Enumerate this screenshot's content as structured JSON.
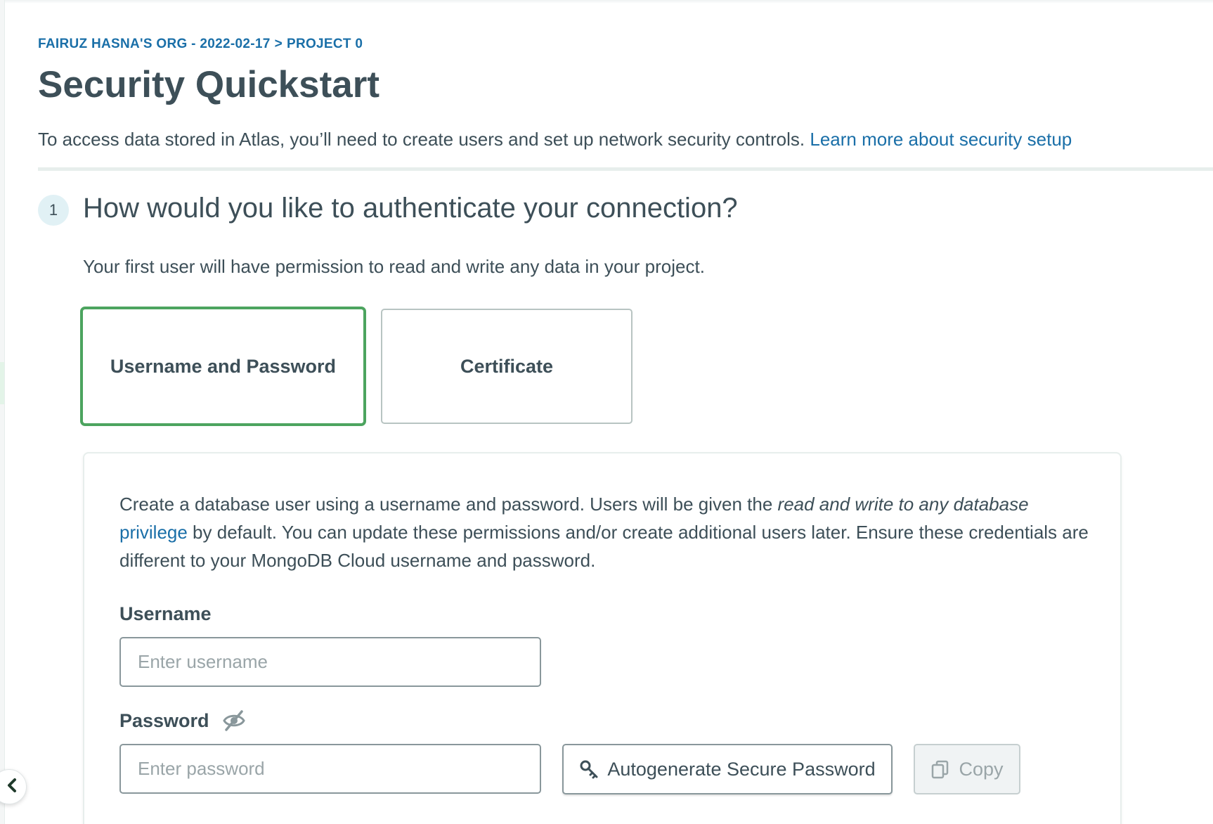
{
  "breadcrumb": {
    "org": "FAIRUZ HASNA'S ORG - 2022-02-17",
    "separator": ">",
    "project": "PROJECT 0"
  },
  "page": {
    "title": "Security Quickstart",
    "intro_text": "To access data stored in Atlas, you’ll need to create users and set up network security controls.",
    "intro_link": "Learn more about security setup"
  },
  "step1": {
    "number": "1",
    "title": "How would you like to authenticate your connection?",
    "subtitle": "Your first user will have permission to read and write any data in your project.",
    "options": [
      {
        "label": "Username and Password",
        "selected": true
      },
      {
        "label": "Certificate",
        "selected": false
      }
    ]
  },
  "form": {
    "desc_part1": "Create a database user using a username and password. Users will be given the ",
    "desc_italic": "read and write to any database",
    "desc_link": "privilege",
    "desc_part2": " by default. You can update these permissions and/or create additional users later. Ensure these credentials are different to your MongoDB Cloud username and password.",
    "username_label": "Username",
    "username_placeholder": "Enter username",
    "username_value": "",
    "password_label": "Password",
    "password_placeholder": "Enter password",
    "password_value": "",
    "autogen_label": "Autogenerate Secure Password",
    "copy_label": "Copy"
  },
  "icons": {
    "password_visibility": "eye-slash-icon",
    "autogen": "key-icon",
    "copy": "copy-icon",
    "collapse": "chevron-left-icon"
  },
  "colors": {
    "accent_link": "#1a6fa8",
    "selected_border": "#4ca45f",
    "text": "#3d4f58"
  }
}
